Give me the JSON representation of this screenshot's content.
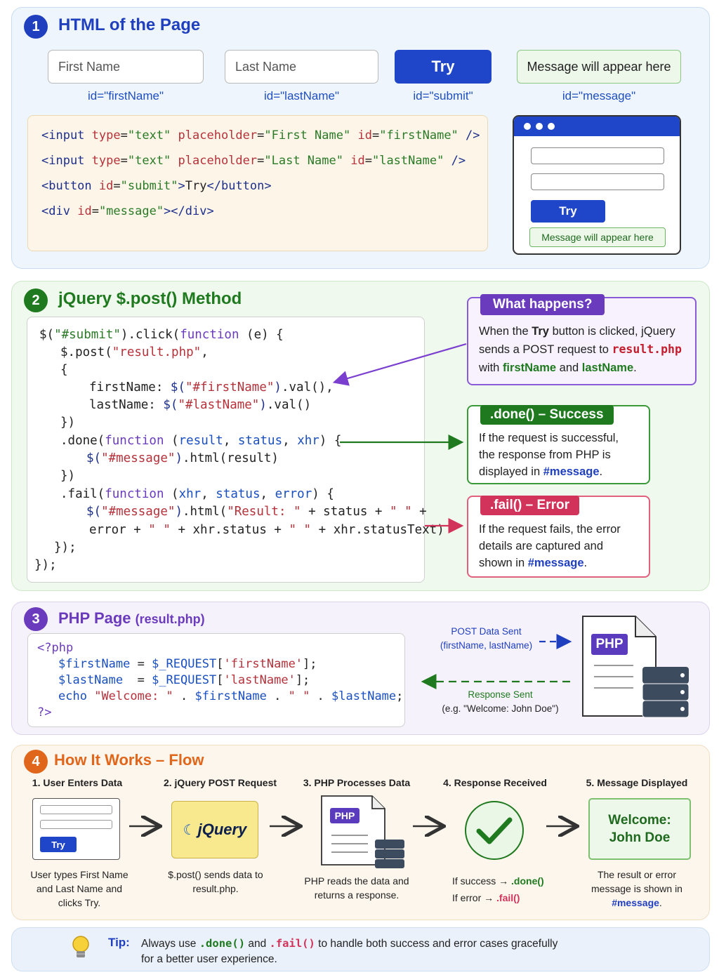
{
  "section1": {
    "number": "1",
    "title": "HTML of the Page",
    "first_name_placeholder": "First Name",
    "last_name_placeholder": "Last Name",
    "try_label": "Try",
    "message_text": "Message will appear here",
    "id_first": "id=\"firstName\"",
    "id_last": "id=\"lastName\"",
    "id_submit": "id=\"submit\"",
    "id_message": "id=\"message\"",
    "mini_try": "Try",
    "mini_message": "Message will appear here"
  },
  "section2": {
    "number": "2",
    "title": "jQuery $.post() Method",
    "what_title": "What happens?",
    "what_p1": "When the ",
    "what_try": "Try",
    "what_p2": " button is clicked, jQuery",
    "what_p3": "sends a POST request to ",
    "what_file": "result.php",
    "what_p4": "with ",
    "what_first": "firstName",
    "what_and": " and ",
    "what_last": "lastName",
    "what_dot": ".",
    "done_title": ".done() – Success",
    "done_l1": "If the request is successful,",
    "done_l2": "the response from PHP is",
    "done_l3": "displayed in ",
    "done_msg": "#message",
    "done_dot": ".",
    "fail_title": ".fail() – Error",
    "fail_l1": "If the request fails, the error",
    "fail_l2": "details are captured and",
    "fail_l3": "shown in ",
    "fail_msg": "#message",
    "fail_dot": "."
  },
  "section3": {
    "number": "3",
    "title": "PHP Page ",
    "title_file": "(result.php)",
    "post_sent": "POST Data Sent",
    "post_fields": "(firstName, lastName)",
    "response_sent": "Response Sent",
    "response_example": "(e.g. \"Welcome: John Doe\")",
    "php_badge": "PHP"
  },
  "section4": {
    "number": "4",
    "title": "How It Works – Flow",
    "steps": [
      {
        "title": "1. User Enters Data",
        "desc": "User types First Name and Last Name and clicks Try."
      },
      {
        "title": "2. jQuery POST Request",
        "desc": "$.post() sends data to result.php."
      },
      {
        "title": "3. PHP Processes Data",
        "desc": "PHP reads the data and returns a response."
      },
      {
        "title": "4. Response Received",
        "desc": ""
      },
      {
        "title": "5. Message Displayed",
        "desc": ""
      }
    ],
    "step1_try": "Try",
    "jquery_logo": "jQuery",
    "php_badge": "PHP",
    "if_success": "If success →",
    "done_ref": ".done()",
    "if_error": "If error →",
    "fail_ref": ".fail()",
    "welcome_l1": "Welcome:",
    "welcome_l2": "John Doe",
    "step5_l1": "The result or error",
    "step5_l2": "message is shown in",
    "step5_msg": "#message",
    "step5_dot": "."
  },
  "tip": {
    "label": "Tip:",
    "text_a": "Always use ",
    "done": ".done()",
    "and": " and ",
    "fail": ".fail()",
    "text_b": " to handle both success and error cases gracefully",
    "text_c": "for a better user experience."
  },
  "colors": {
    "blue": "#1f3fbf",
    "green": "#1f7a1f",
    "purple": "#6a3bbd",
    "orange": "#e0661b",
    "red": "#d2335a"
  }
}
